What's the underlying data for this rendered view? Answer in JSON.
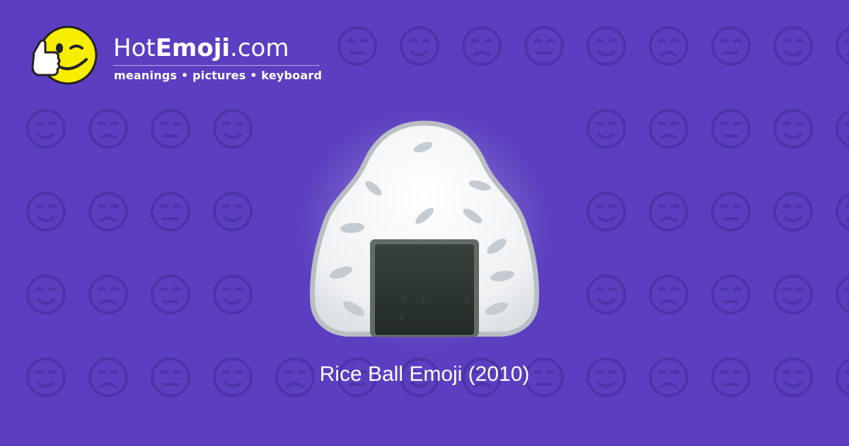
{
  "brand": {
    "name_part1": "Hot",
    "name_part2": "Emoji",
    "name_part3": ".com",
    "tagline": "meanings • pictures • keyboard",
    "mascot_icon": "winking-thumbs-up-smiley-icon"
  },
  "emoji": {
    "icon": "rice-ball-icon",
    "caption": "Rice Ball Emoji (2010)"
  },
  "colors": {
    "background": "#5b3fc0",
    "pattern": "#4c33a8",
    "text": "#ffffff",
    "mascot_face": "#f7ee00",
    "nori": "#2b332d"
  }
}
